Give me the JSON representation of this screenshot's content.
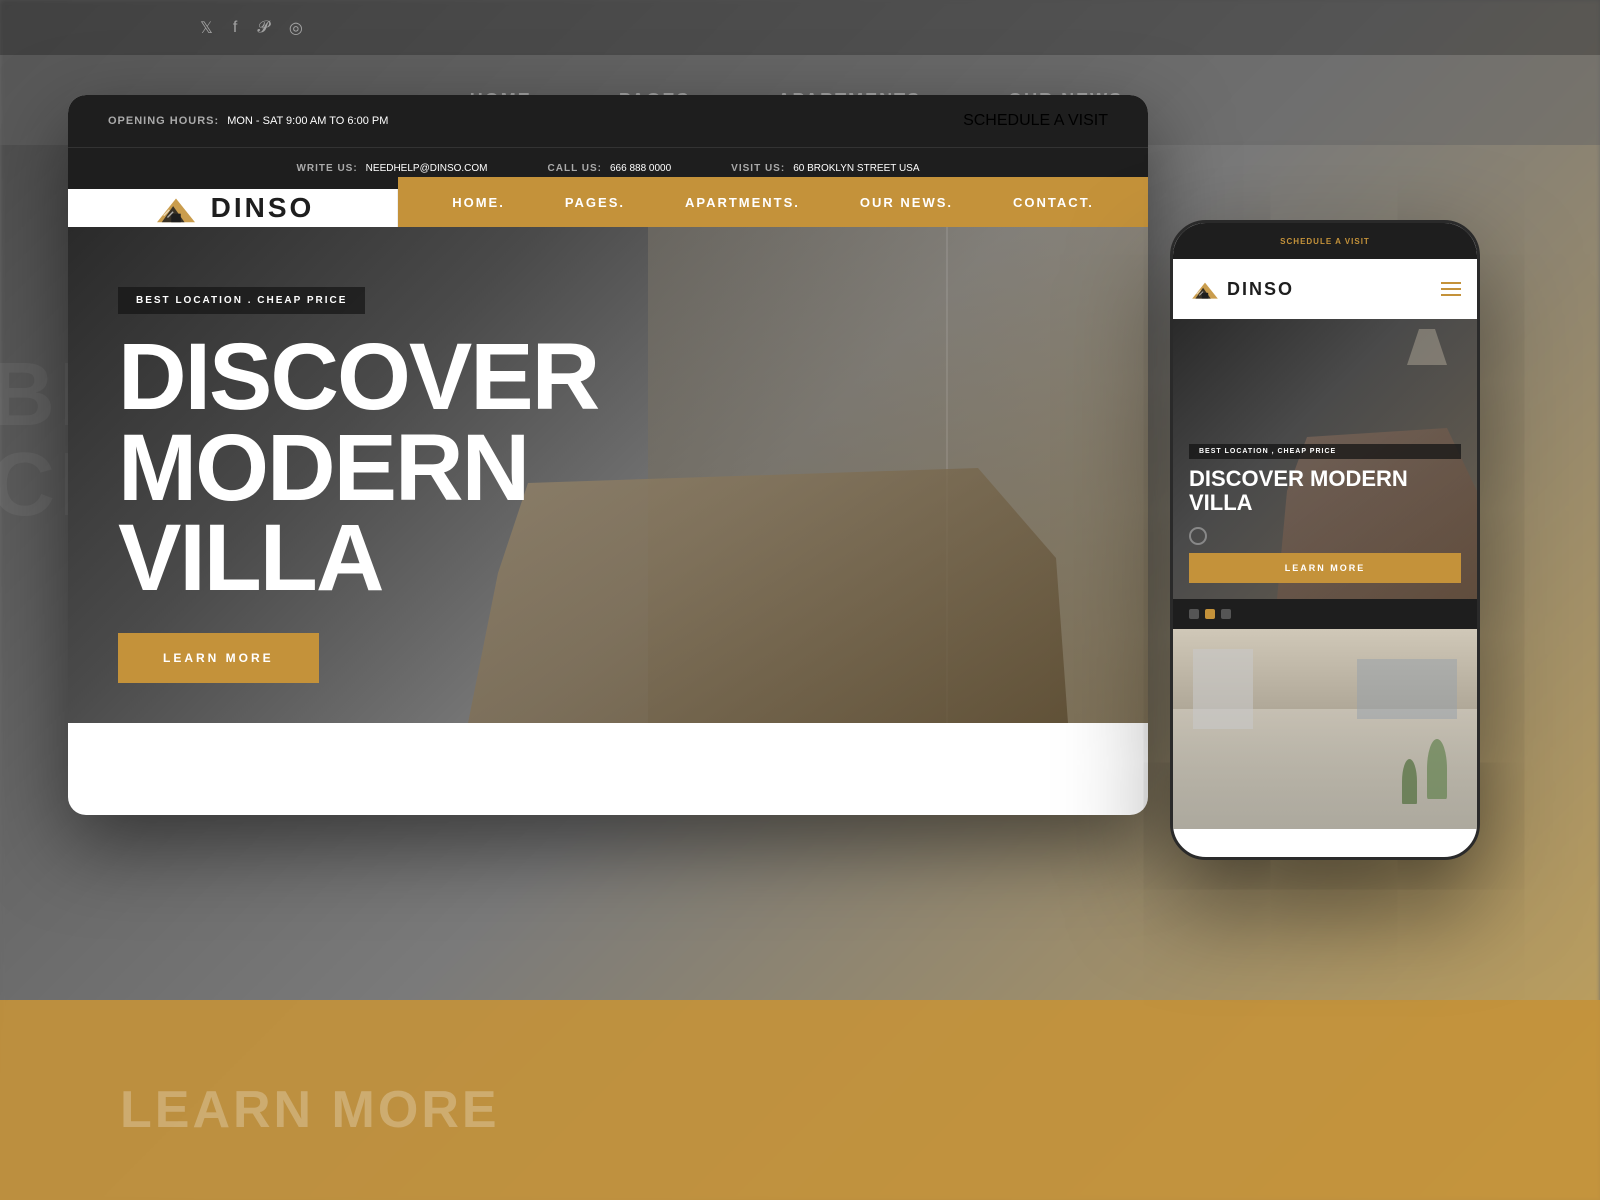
{
  "background": {
    "color": "#6b6b6b"
  },
  "brand": {
    "name": "DINSO",
    "accent_color": "#c4923a",
    "dark_color": "#1e1e1e"
  },
  "desktop": {
    "topbar": {
      "opening_label": "OPENING HOURS:",
      "opening_value": "MON - SAT 9:00 AM TO 6:00 PM",
      "schedule_label": "SCHEDULE A VISIT"
    },
    "contact_bar": {
      "write_label": "WRITE US:",
      "write_value": "NEEDHELP@DINSO.COM",
      "call_label": "CALL US:",
      "call_value": "666 888 0000",
      "visit_label": "VISIT US:",
      "visit_value": "60 BROKLYN STREET USA"
    },
    "nav": {
      "items": [
        "HOME.",
        "PAGES.",
        "APARTMENTS.",
        "OUR NEWS.",
        "CONTACT."
      ]
    },
    "hero": {
      "badge": "BEST LOCATION . CHEAP PRICE",
      "title_line1": "DISCOVER",
      "title_line2": "MODERN",
      "title_line3": "VILLA",
      "cta_label": "LEARN MORE"
    }
  },
  "mobile": {
    "topbar": {
      "schedule_label": "SCHEDULE A VISIT"
    },
    "hero": {
      "badge": "BEST LOCATION , CHEAP PRICE",
      "title": "DISCOVER MODERN VILLA",
      "cta_label": "LEARN MORE"
    }
  },
  "background_nav": {
    "items": [
      "HOME.",
      "PAGES.",
      "APARTMENTS.",
      "OUR NEWS."
    ]
  },
  "vertical_text": {
    "line1": "BEST Location",
    "line2": "cheAP Price"
  },
  "bottom_text": "LEARN MORE"
}
